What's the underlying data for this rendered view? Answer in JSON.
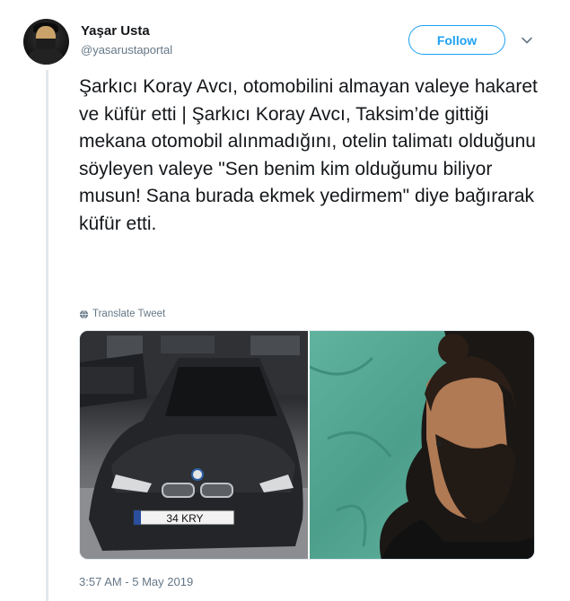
{
  "tweet": {
    "author": {
      "display_name": "Yaşar Usta",
      "handle": "@yasarustaportal"
    },
    "follow_label": "Follow",
    "text": "Şarkıcı Koray Avcı, otomobilini almayan valeye hakaret ve küfür etti | Şarkıcı Koray Avcı, Taksim’de gittiği mekana otomobil alınmadığını, otelin talimatı olduğunu söyleyen valeye \"Sen benim kim olduğumu biliyor musun! Sana burada ekmek yedirmem\" diye bağırarak küfür etti.",
    "translate_label": "Translate Tweet",
    "media": {
      "plate_text": "34 KRY"
    },
    "timestamp": "3:57 AM - 5 May 2019"
  },
  "colors": {
    "accent": "#1da1f2",
    "secondary_text": "#657786",
    "primary_text": "#14171a"
  },
  "icons": [
    "chevron-down-icon",
    "globe-icon"
  ]
}
